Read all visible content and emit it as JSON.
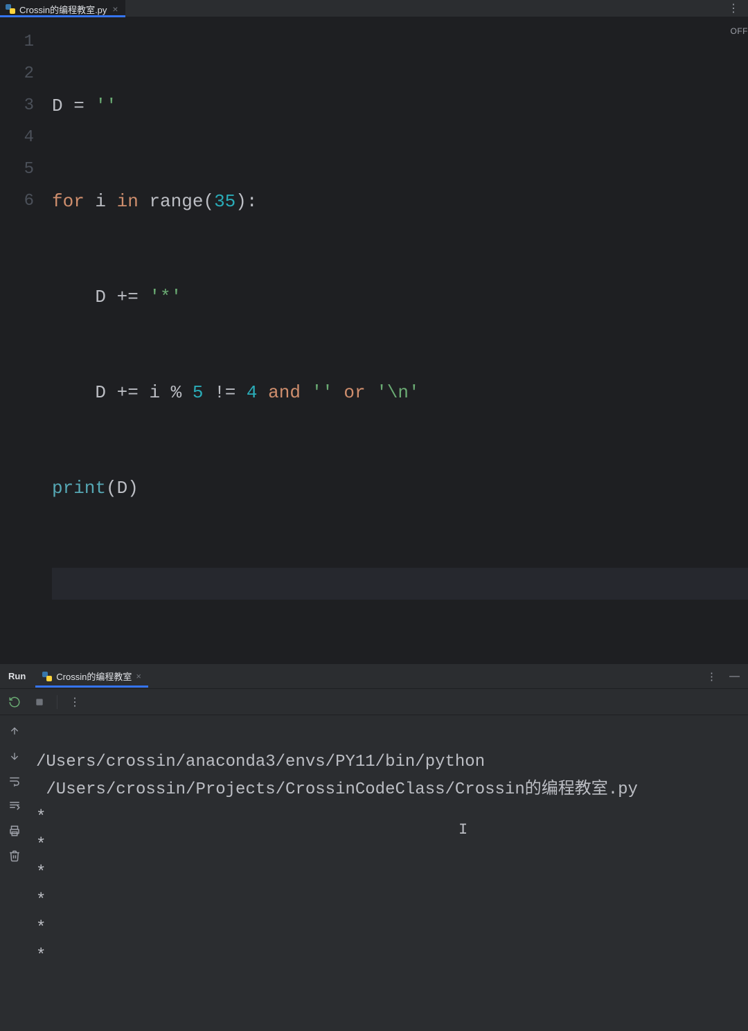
{
  "editor": {
    "tab": {
      "filename": "Crossin的编程教室.py"
    },
    "status_right": "OFF",
    "lines": [
      "1",
      "2",
      "3",
      "4",
      "5",
      "6"
    ],
    "code": {
      "l1": {
        "a": "D ",
        "b": "= ",
        "c": "''"
      },
      "l2": {
        "a": "for ",
        "b": "i ",
        "c": "in ",
        "d": "range",
        "e": "(",
        "f": "35",
        "g": "):"
      },
      "l3": {
        "a": "D ",
        "b": "+= ",
        "c": "'*'"
      },
      "l4": {
        "a": "D ",
        "b": "+= ",
        "c": "i ",
        "d": "% ",
        "e": "5 ",
        "f": "!= ",
        "g": "4 ",
        "h": "and ",
        "i": "'' ",
        "j": "or ",
        "k": "'\\n'"
      },
      "l5": {
        "a": "print",
        "b": "(D)"
      }
    }
  },
  "run": {
    "title": "Run",
    "tab": "Crossin的编程教室",
    "cmd1": "/Users/crossin/anaconda3/envs/PY11/bin/python",
    "cmd2": " /Users/crossin/Projects/CrossinCodeClass/Crossin的编程教室.py",
    "output": [
      "*",
      "*",
      "*",
      "*",
      "*",
      "*"
    ]
  }
}
